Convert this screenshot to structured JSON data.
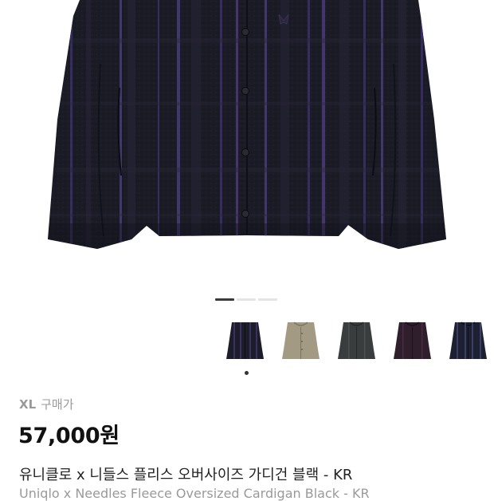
{
  "product": {
    "size_label": "XL",
    "purchase_label": "구매가",
    "price": "57,000원",
    "title_ko": "유니클로 x 니들스 플리스 오버사이즈 가디건 블랙 - KR",
    "title_en": "Uniqlo x Needles Fleece Oversized Cardigan Black - KR"
  },
  "gallery": {
    "page_count": 3,
    "active_page": 1
  },
  "thumbnails": [
    {
      "name": "black",
      "color": "#1d1d2a",
      "stripe": "#3b2f63",
      "selected": true
    },
    {
      "name": "beige",
      "color": "#a39a84",
      "stripe": "#8c846f",
      "selected": false
    },
    {
      "name": "charcoal",
      "color": "#3a3d3d",
      "stripe": "#4c504f",
      "selected": false
    },
    {
      "name": "purple",
      "color": "#2f1e2b",
      "stripe": "#4a2a40",
      "selected": false
    },
    {
      "name": "navy",
      "color": "#1c2030",
      "stripe": "#3a3f63",
      "selected": false
    }
  ],
  "colors": {
    "jacket_body": "#1b1b26",
    "jacket_stripe": "#4a3b7a",
    "button": "#2a2a32",
    "price_text": "#111111",
    "muted_text": "#9a9a9a"
  }
}
